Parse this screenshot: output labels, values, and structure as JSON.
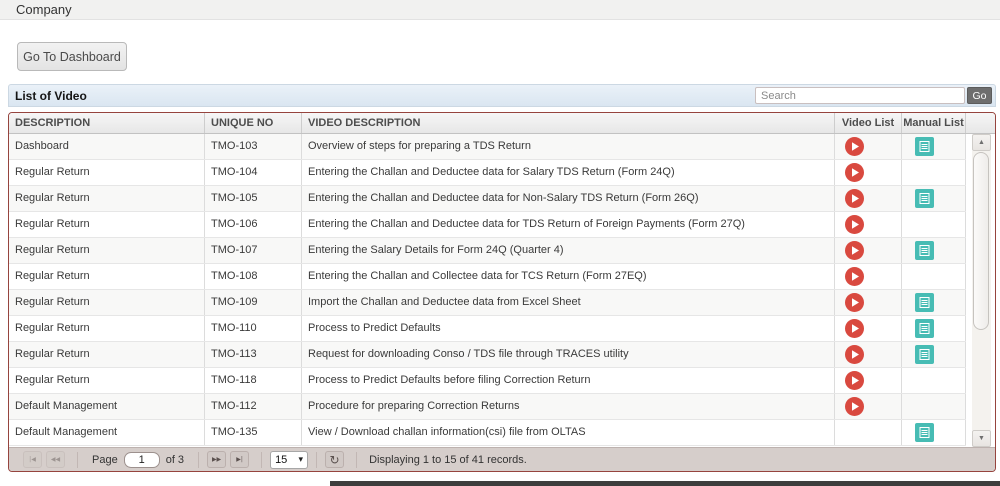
{
  "header": {
    "title": "Company",
    "dashboard_button": "Go To Dashboard"
  },
  "panel": {
    "title": "List of Video",
    "search": {
      "placeholder": "Search",
      "go_label": "Go"
    }
  },
  "table": {
    "columns": [
      "DESCRIPTION",
      "UNIQUE NO",
      "VIDEO DESCRIPTION",
      "Video List",
      "Manual List"
    ],
    "rows": [
      {
        "description": "Dashboard",
        "unique_no": "TMO-103",
        "video_description": "Overview of steps for preparing a TDS Return",
        "video": true,
        "manual": true
      },
      {
        "description": "Regular Return",
        "unique_no": "TMO-104",
        "video_description": "Entering the Challan and Deductee data for Salary TDS Return (Form 24Q)",
        "video": true,
        "manual": false
      },
      {
        "description": "Regular Return",
        "unique_no": "TMO-105",
        "video_description": "Entering the Challan and Deductee data for Non-Salary TDS Return (Form 26Q)",
        "video": true,
        "manual": true
      },
      {
        "description": "Regular Return",
        "unique_no": "TMO-106",
        "video_description": "Entering the Challan and Deductee data for TDS Return of Foreign Payments (Form 27Q)",
        "video": true,
        "manual": false
      },
      {
        "description": "Regular Return",
        "unique_no": "TMO-107",
        "video_description": "Entering the Salary Details for Form 24Q (Quarter 4)",
        "video": true,
        "manual": true
      },
      {
        "description": "Regular Return",
        "unique_no": "TMO-108",
        "video_description": "Entering the Challan and Collectee data for TCS Return (Form 27EQ)",
        "video": true,
        "manual": false
      },
      {
        "description": "Regular Return",
        "unique_no": "TMO-109",
        "video_description": "Import the Challan and Deductee data from Excel Sheet",
        "video": true,
        "manual": true
      },
      {
        "description": "Regular Return",
        "unique_no": "TMO-110",
        "video_description": "Process to Predict Defaults",
        "video": true,
        "manual": true
      },
      {
        "description": "Regular Return",
        "unique_no": "TMO-113",
        "video_description": "Request for downloading Conso / TDS file through TRACES utility",
        "video": true,
        "manual": true
      },
      {
        "description": "Regular Return",
        "unique_no": "TMO-118",
        "video_description": "Process to Predict Defaults before filing Correction Return",
        "video": true,
        "manual": false
      },
      {
        "description": "Default Management",
        "unique_no": "TMO-112",
        "video_description": "Procedure for preparing Correction Returns",
        "video": true,
        "manual": false
      },
      {
        "description": "Default Management",
        "unique_no": "TMO-135",
        "video_description": "View / Download challan information(csi) file from OLTAS",
        "video": false,
        "manual": true
      }
    ]
  },
  "pager": {
    "first_glyph": "|◀",
    "prev_glyph": "◀◀",
    "next_glyph": "▶▶",
    "last_glyph": "▶|",
    "page_label": "Page",
    "current_page": "1",
    "of_label": "of 3",
    "page_size": "15",
    "refresh_glyph": "↻",
    "summary": "Displaying 1 to 15 of 41 records."
  },
  "colors": {
    "play_icon": "#d9493f",
    "manual_icon": "#47bcb4",
    "table_border": "#96443e",
    "panel_header_bg": "#e2ebf4",
    "pager_bg": "#d6cecb",
    "go_button_bg": "#6e6e6e"
  }
}
